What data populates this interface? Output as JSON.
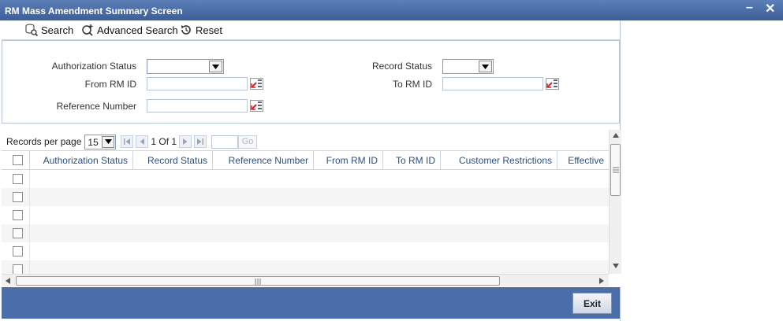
{
  "window": {
    "title": "RM Mass Amendment Summary Screen",
    "minimize": "–",
    "close": "✕"
  },
  "toolbar": {
    "search_label": "Search",
    "advanced_search_label": "Advanced Search",
    "reset_label": "Reset"
  },
  "criteria": {
    "authorization_status": {
      "label": "Authorization Status",
      "value": ""
    },
    "record_status": {
      "label": "Record Status",
      "value": ""
    },
    "from_rm_id": {
      "label": "From RM ID",
      "value": ""
    },
    "to_rm_id": {
      "label": "To RM ID",
      "value": ""
    },
    "reference_number": {
      "label": "Reference Number",
      "value": ""
    }
  },
  "pager": {
    "records_per_page_label": "Records per page",
    "records_per_page": "15",
    "page_info": "1 Of 1",
    "go_label": "Go"
  },
  "grid": {
    "columns": [
      "Authorization Status",
      "Record Status",
      "Reference Number",
      "From RM ID",
      "To RM ID",
      "Customer Restrictions",
      "Effective"
    ]
  },
  "footer": {
    "exit_label": "Exit"
  },
  "colors": {
    "title_bar": "#3d5e98",
    "footer": "#4a6ea9",
    "header_text": "#2c4f86"
  }
}
